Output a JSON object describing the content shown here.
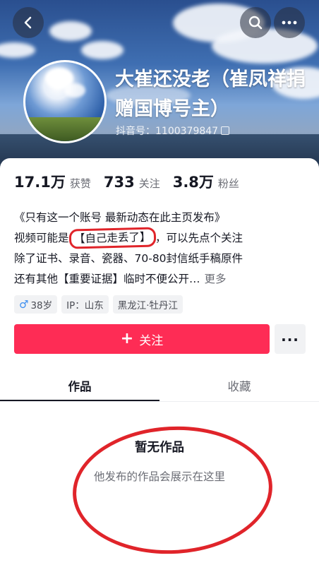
{
  "header": {
    "nickname": "大崔还没老（崔凤祥捐赠国博号主）",
    "douyin_id": "抖音号：1100379847",
    "icons": {
      "back": "chevron-left-icon",
      "search": "search-icon",
      "more": "more-icon",
      "copy": "copy-icon"
    }
  },
  "stats": [
    {
      "num": "17.1万",
      "label": "获赞"
    },
    {
      "num": "733",
      "label": "关注"
    },
    {
      "num": "3.8万",
      "label": "粉丝"
    }
  ],
  "bio": {
    "line1": "《只有这一个账号 最新动态在此主页发布》",
    "line2_prefix": "视频可能是",
    "line2_highlight": "【自己走丢了】",
    "line2_suffix": "，可以先点个关注",
    "line3": "除了证书、录音、瓷器、70-80封信纸手稿原件",
    "line4": "还有其他【重要证据】临时不便公开…",
    "more": "更多"
  },
  "tags": {
    "age": "38岁",
    "ip": "IP：山东",
    "location": "黑龙江·牡丹江"
  },
  "actions": {
    "follow_label": "关注",
    "more_dots": "..."
  },
  "tabs": {
    "works": "作品",
    "favorites": "收藏"
  },
  "empty": {
    "title": "暂无作品",
    "subtitle": "他发布的作品会展示在这里"
  },
  "colors": {
    "accent": "#fe2c55",
    "annotation": "#e0242a",
    "male": "#3c8ef0"
  }
}
